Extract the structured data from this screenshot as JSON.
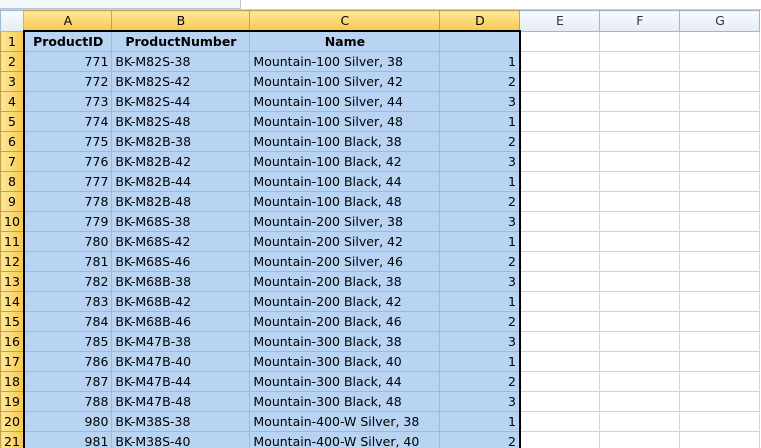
{
  "columns": [
    "A",
    "B",
    "C",
    "D",
    "E",
    "F",
    "G"
  ],
  "header_row": [
    "ProductID",
    "ProductNumber",
    "Name",
    ""
  ],
  "rows": [
    {
      "n": "2",
      "id": "771",
      "num": "BK-M82S-38",
      "name": "Mountain-100 Silver, 38",
      "d": "1"
    },
    {
      "n": "3",
      "id": "772",
      "num": "BK-M82S-42",
      "name": "Mountain-100 Silver, 42",
      "d": "2"
    },
    {
      "n": "4",
      "id": "773",
      "num": "BK-M82S-44",
      "name": "Mountain-100 Silver, 44",
      "d": "3"
    },
    {
      "n": "5",
      "id": "774",
      "num": "BK-M82S-48",
      "name": "Mountain-100 Silver, 48",
      "d": "1"
    },
    {
      "n": "6",
      "id": "775",
      "num": "BK-M82B-38",
      "name": "Mountain-100 Black, 38",
      "d": "2"
    },
    {
      "n": "7",
      "id": "776",
      "num": "BK-M82B-42",
      "name": "Mountain-100 Black, 42",
      "d": "3"
    },
    {
      "n": "8",
      "id": "777",
      "num": "BK-M82B-44",
      "name": "Mountain-100 Black, 44",
      "d": "1"
    },
    {
      "n": "9",
      "id": "778",
      "num": "BK-M82B-48",
      "name": "Mountain-100 Black, 48",
      "d": "2"
    },
    {
      "n": "10",
      "id": "779",
      "num": "BK-M68S-38",
      "name": "Mountain-200 Silver, 38",
      "d": "3"
    },
    {
      "n": "11",
      "id": "780",
      "num": "BK-M68S-42",
      "name": "Mountain-200 Silver, 42",
      "d": "1"
    },
    {
      "n": "12",
      "id": "781",
      "num": "BK-M68S-46",
      "name": "Mountain-200 Silver, 46",
      "d": "2"
    },
    {
      "n": "13",
      "id": "782",
      "num": "BK-M68B-38",
      "name": "Mountain-200 Black, 38",
      "d": "3"
    },
    {
      "n": "14",
      "id": "783",
      "num": "BK-M68B-42",
      "name": "Mountain-200 Black, 42",
      "d": "1"
    },
    {
      "n": "15",
      "id": "784",
      "num": "BK-M68B-46",
      "name": "Mountain-200 Black, 46",
      "d": "2"
    },
    {
      "n": "16",
      "id": "785",
      "num": "BK-M47B-38",
      "name": "Mountain-300 Black, 38",
      "d": "3"
    },
    {
      "n": "17",
      "id": "786",
      "num": "BK-M47B-40",
      "name": "Mountain-300 Black, 40",
      "d": "1"
    },
    {
      "n": "18",
      "id": "787",
      "num": "BK-M47B-44",
      "name": "Mountain-300 Black, 44",
      "d": "2"
    },
    {
      "n": "19",
      "id": "788",
      "num": "BK-M47B-48",
      "name": "Mountain-300 Black, 48",
      "d": "3"
    },
    {
      "n": "20",
      "id": "980",
      "num": "BK-M38S-38",
      "name": "Mountain-400-W Silver, 38",
      "d": "1"
    },
    {
      "n": "21",
      "id": "981",
      "num": "BK-M38S-40",
      "name": "Mountain-400-W Silver, 40",
      "d": "2"
    }
  ],
  "colors": {
    "selection": "#b9d4f2",
    "header_highlight": "#f7c850",
    "border": "#000000"
  }
}
